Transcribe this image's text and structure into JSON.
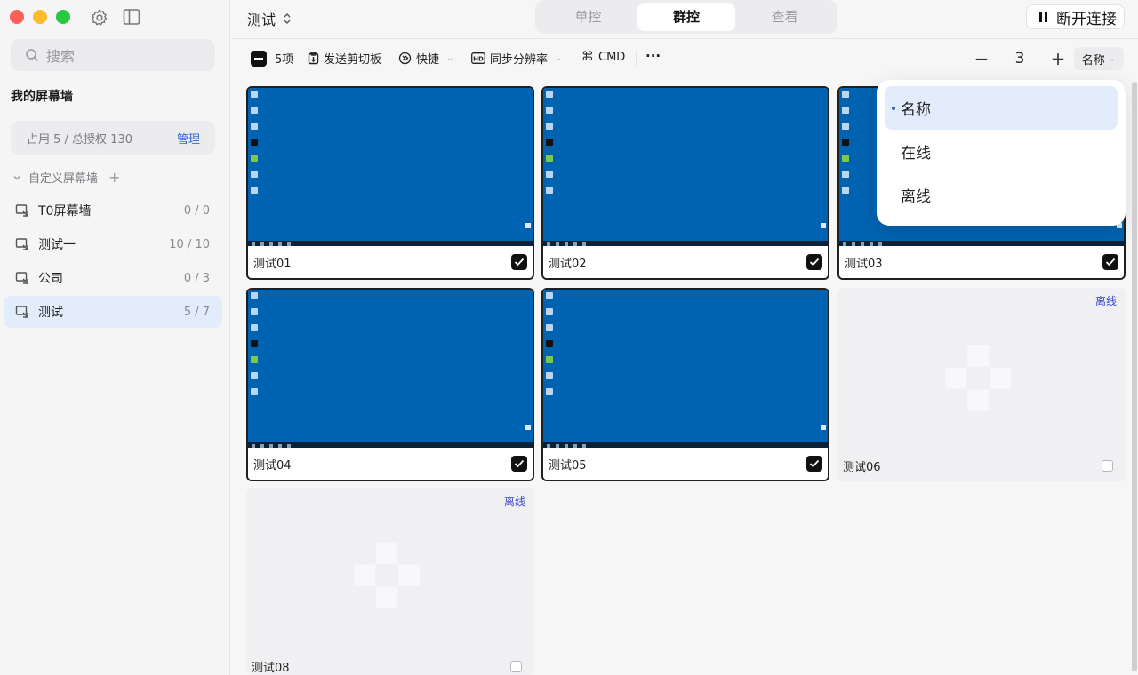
{
  "sidebar": {
    "search_placeholder": "搜索",
    "wall_title": "我的屏幕墙",
    "quota_text": "占用 5 / 总授权 130",
    "manage_label": "管理",
    "custom_header": "自定义屏幕墙",
    "items": [
      {
        "label": "T0屏幕墙",
        "count": "0 / 0"
      },
      {
        "label": "测试一",
        "count": "10 / 10"
      },
      {
        "label": "公司",
        "count": "0 / 3"
      },
      {
        "label": "测试",
        "count": "5 / 7"
      }
    ]
  },
  "header": {
    "group_name": "测试",
    "tabs": [
      "单控",
      "群控",
      "查看"
    ],
    "active_tab": "群控",
    "disconnect_label": "断开连接"
  },
  "toolbar": {
    "selected_count": "5项",
    "clipboard_label": "发送剪切板",
    "shortcut_label": "快捷",
    "resolution_label": "同步分辨率",
    "cmd_label": "CMD",
    "more_label": "···",
    "columns_value": "3",
    "sort_label": "名称"
  },
  "devices": [
    {
      "name": "测试01",
      "status": "online",
      "checked": true
    },
    {
      "name": "测试02",
      "status": "online",
      "checked": true
    },
    {
      "name": "测试03",
      "status": "online",
      "checked": true
    },
    {
      "name": "测试04",
      "status": "online",
      "checked": true
    },
    {
      "name": "测试05",
      "status": "online",
      "checked": true
    },
    {
      "name": "测试06",
      "status": "offline",
      "checked": false
    },
    {
      "name": "测试08",
      "status": "offline",
      "checked": false
    }
  ],
  "offline_badge": "离线",
  "sort_menu": {
    "options": [
      "名称",
      "在线",
      "离线"
    ],
    "selected": "名称"
  },
  "colors": {
    "accent": "#2f63d6",
    "desktop_blue": "#0063b1",
    "offline_badge": "#3a46c9",
    "selected_bg": "#e3ecfb"
  }
}
